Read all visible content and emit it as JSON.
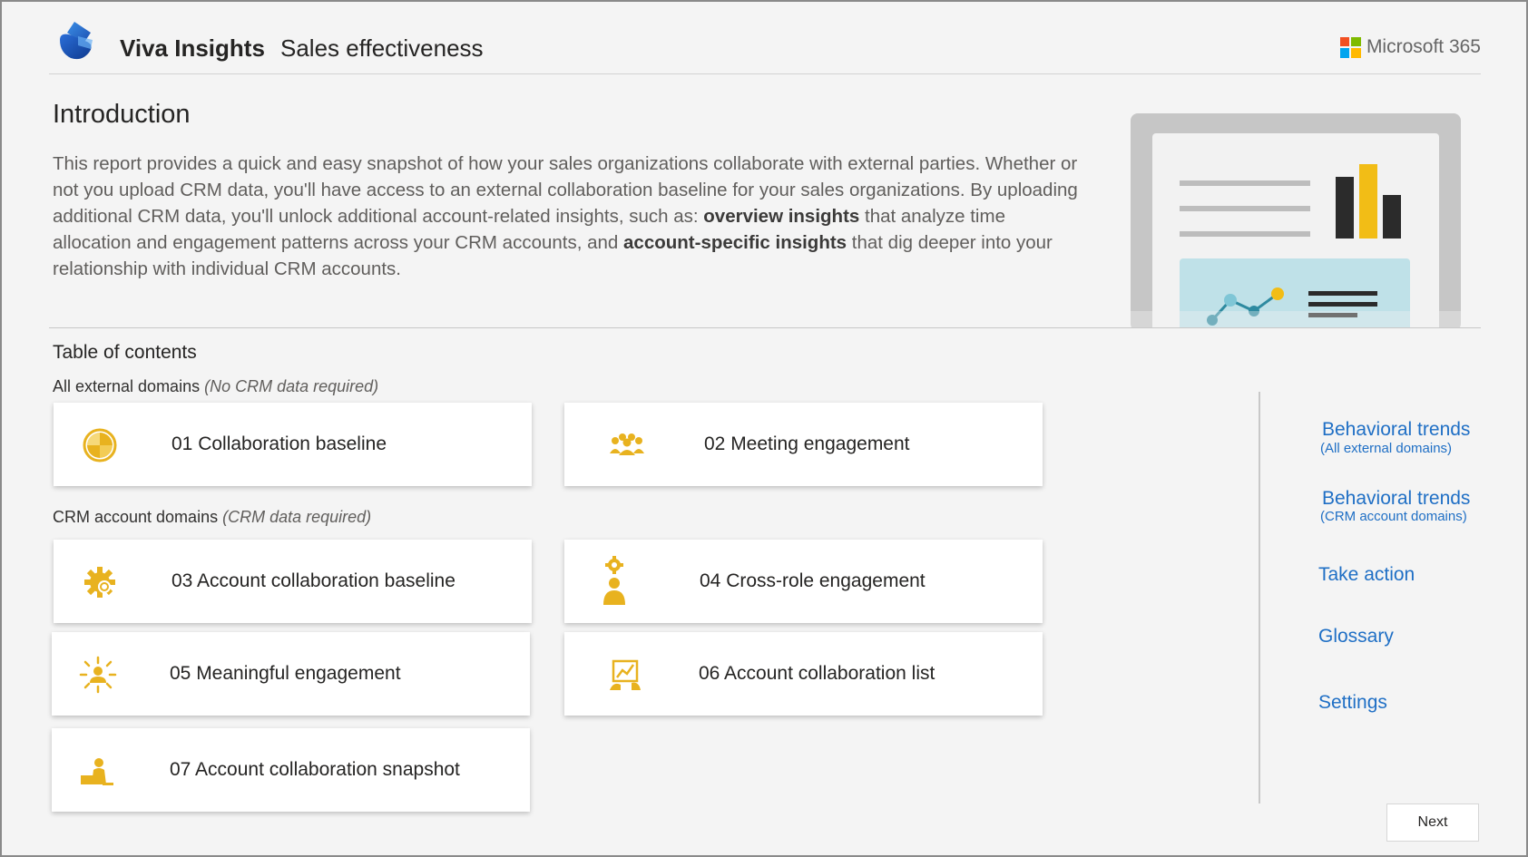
{
  "header": {
    "app_title": "Viva Insights",
    "section_title": "Sales effectiveness",
    "brand_text": "Microsoft 365",
    "ms_logo_colors": [
      "#f25022",
      "#7fba00",
      "#00a4ef",
      "#ffb900"
    ]
  },
  "intro": {
    "title": "Introduction",
    "p1": "This report provides a quick and easy snapshot of how your sales organizations collaborate with external parties. Whether or not you upload CRM data, you'll have access to an external collaboration baseline for your sales organizations. By uploading additional CRM data, you'll unlock additional account-related insights, such as: ",
    "bold1": "overview insights",
    "p2": " that analyze time allocation and engagement patterns across your CRM accounts, and ",
    "bold2": "account-specific insights",
    "p3": " that dig deeper into your relationship with individual CRM accounts."
  },
  "toc": {
    "title": "Table of contents",
    "group1": {
      "label": "All external domains",
      "note": "(No CRM data required)"
    },
    "group2": {
      "label": "CRM account domains",
      "note": "(CRM data required)"
    },
    "cards": [
      {
        "label": "01 Collaboration baseline",
        "icon": "pie-chart-icon"
      },
      {
        "label": "02 Meeting engagement",
        "icon": "people-group-icon"
      },
      {
        "label": "03 Account collaboration baseline",
        "icon": "gear-icon"
      },
      {
        "label": "04 Cross-role engagement",
        "icon": "person-gear-icon"
      },
      {
        "label": "05 Meaningful engagement",
        "icon": "person-radiate-icon"
      },
      {
        "label": "06 Account collaboration list",
        "icon": "chart-list-icon"
      },
      {
        "label": "07 Account collaboration snapshot",
        "icon": "person-desk-icon"
      }
    ]
  },
  "nav": {
    "trends_all": "Behavioral trends",
    "trends_all_sub": "(All external domains)",
    "trends_crm": "Behavioral trends",
    "trends_crm_sub": "(CRM account domains)",
    "take_action": "Take action",
    "glossary": "Glossary",
    "settings": "Settings"
  },
  "footer": {
    "next_label": "Next"
  },
  "colors": {
    "accent_gold": "#e8b21f",
    "link_blue": "#1f6fc5"
  }
}
